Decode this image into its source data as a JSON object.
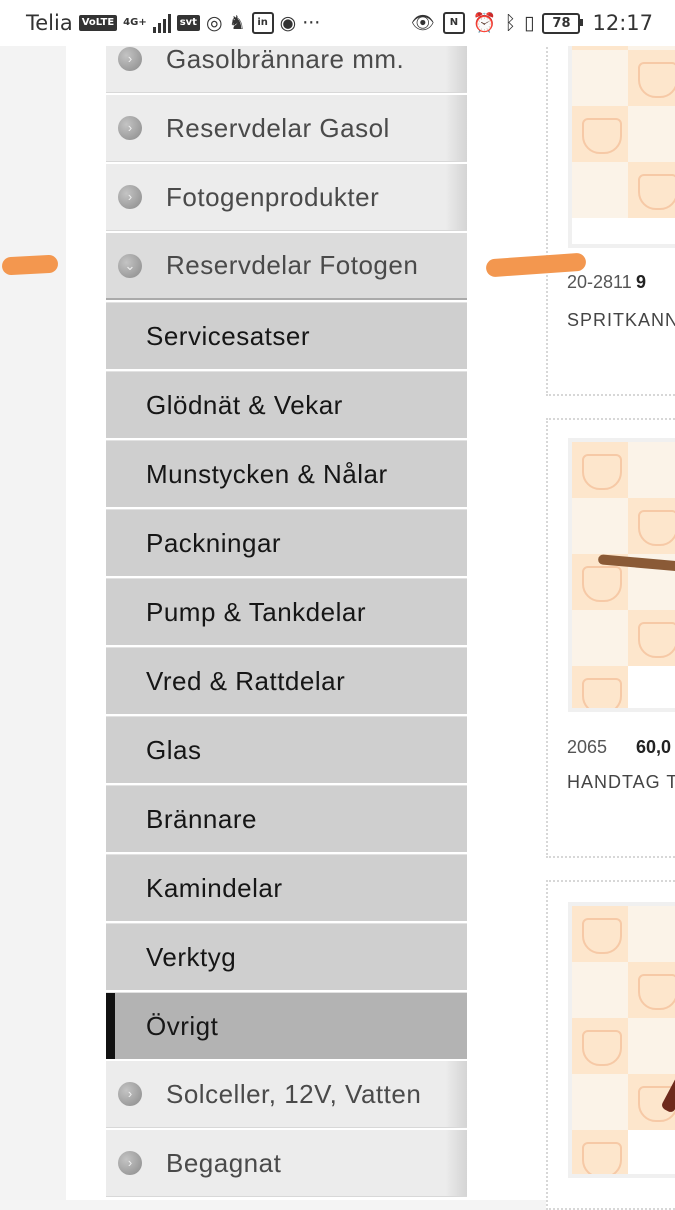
{
  "status_bar": {
    "carrier": "Telia",
    "volte": "VoLTE",
    "network": "4G+",
    "svt": "svt",
    "battery": "78",
    "time": "12:17"
  },
  "menu": {
    "categories_top": [
      {
        "label": "Gasolbrännare mm."
      },
      {
        "label": "Reservdelar Gasol"
      },
      {
        "label": "Fotogenprodukter"
      }
    ],
    "open_category": {
      "label": "Reservdelar Fotogen"
    },
    "subcategories": [
      {
        "label": "Servicesatser"
      },
      {
        "label": "Glödnät & Vekar"
      },
      {
        "label": "Munstycken & Nålar"
      },
      {
        "label": "Packningar"
      },
      {
        "label": "Pump & Tankdelar"
      },
      {
        "label": "Vred & Rattdelar"
      },
      {
        "label": "Glas"
      },
      {
        "label": "Brännare"
      },
      {
        "label": "Kamindelar"
      },
      {
        "label": "Verktyg"
      },
      {
        "label": "Övrigt",
        "active": true
      }
    ],
    "categories_bottom": [
      {
        "label": "Solceller, 12V, Vatten"
      },
      {
        "label": "Begagnat"
      }
    ]
  },
  "products": [
    {
      "code": "20-2811",
      "price": "9",
      "name": "SPRITKANN"
    },
    {
      "code": "2065",
      "price": "60,0",
      "name": "HANDTAG T"
    }
  ],
  "colors": {
    "scribble": "#f3974f",
    "active_marker": "#111111"
  }
}
